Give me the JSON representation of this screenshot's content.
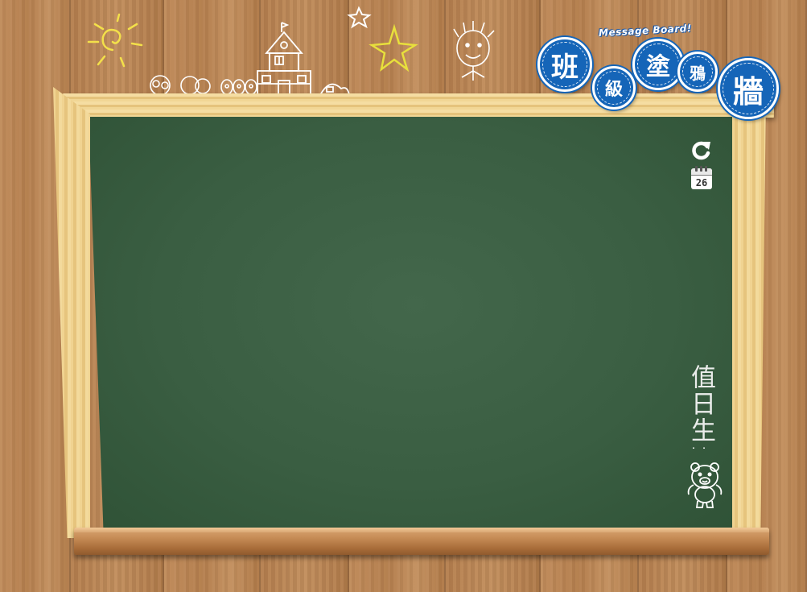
{
  "header": {
    "subtitle": "Message Board!",
    "title_chars": [
      "班",
      "級",
      "塗",
      "鴉",
      "牆"
    ]
  },
  "board": {
    "duty_label": "值日生:",
    "calendar_day": "26"
  },
  "icons": {
    "refresh": "refresh-icon",
    "calendar": "calendar-icon",
    "bear": "bear-doodle-icon"
  },
  "colors": {
    "badge_blue": "#1565b8",
    "board_green": "#3a5e42",
    "wood": "#b98352",
    "frame": "#f0d391"
  }
}
